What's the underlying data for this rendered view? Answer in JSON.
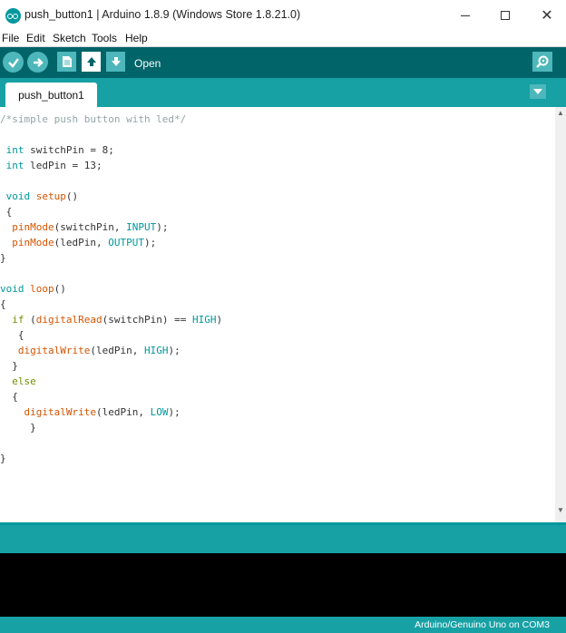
{
  "window": {
    "title": "push_button1 | Arduino 1.8.9 (Windows Store 1.8.21.0)",
    "minimize_glyph": "",
    "close_glyph": "✕"
  },
  "menu": [
    "File",
    "Edit",
    "Sketch",
    "Tools",
    "Help"
  ],
  "toolbar": {
    "hover_label": "Open",
    "buttons": [
      "verify-icon",
      "upload-icon",
      "new-icon",
      "open-icon",
      "save-icon"
    ],
    "right_button": "serial-monitor-icon"
  },
  "tabs": [
    {
      "label": "push_button1",
      "active": true
    }
  ],
  "colors": {
    "toolbar_bg": "#006468",
    "tab_bar_bg": "#17a1a5",
    "button_bg": "#4db7bb",
    "keyword_type": "#00979c",
    "function": "#d35400",
    "comment": "#95a5a6",
    "console_bg": "#000000"
  },
  "code": [
    [
      {
        "t": "/*simple push button with led*/",
        "c": "cm"
      }
    ],
    [],
    [
      {
        "t": " "
      },
      {
        "t": "int",
        "c": "ty"
      },
      {
        "t": " switchPin = 8;"
      }
    ],
    [
      {
        "t": " "
      },
      {
        "t": "int",
        "c": "ty"
      },
      {
        "t": " ledPin = 13;"
      }
    ],
    [],
    [
      {
        "t": " "
      },
      {
        "t": "void",
        "c": "ty"
      },
      {
        "t": " "
      },
      {
        "t": "setup",
        "c": "fn"
      },
      {
        "t": "()"
      }
    ],
    [
      {
        "t": " {"
      }
    ],
    [
      {
        "t": "  "
      },
      {
        "t": "pinMode",
        "c": "fn"
      },
      {
        "t": "(switchPin, "
      },
      {
        "t": "INPUT",
        "c": "cs"
      },
      {
        "t": ");"
      }
    ],
    [
      {
        "t": "  "
      },
      {
        "t": "pinMode",
        "c": "fn"
      },
      {
        "t": "(ledPin, "
      },
      {
        "t": "OUTPUT",
        "c": "cs"
      },
      {
        "t": ");"
      }
    ],
    [
      {
        "t": "}"
      }
    ],
    [],
    [
      {
        "t": "void",
        "c": "ty"
      },
      {
        "t": " "
      },
      {
        "t": "loop",
        "c": "fn"
      },
      {
        "t": "()"
      }
    ],
    [
      {
        "t": "{"
      }
    ],
    [
      {
        "t": "  "
      },
      {
        "t": "if",
        "c": "kw"
      },
      {
        "t": " ("
      },
      {
        "t": "digitalRead",
        "c": "fn"
      },
      {
        "t": "(switchPin) == "
      },
      {
        "t": "HIGH",
        "c": "cs"
      },
      {
        "t": ")"
      }
    ],
    [
      {
        "t": "   {"
      }
    ],
    [
      {
        "t": "   "
      },
      {
        "t": "digitalWrite",
        "c": "fn"
      },
      {
        "t": "(ledPin, "
      },
      {
        "t": "HIGH",
        "c": "cs"
      },
      {
        "t": ");"
      }
    ],
    [
      {
        "t": "  }"
      }
    ],
    [
      {
        "t": "  "
      },
      {
        "t": "else",
        "c": "kw"
      }
    ],
    [
      {
        "t": "  {"
      }
    ],
    [
      {
        "t": "    "
      },
      {
        "t": "digitalWrite",
        "c": "fn"
      },
      {
        "t": "(ledPin, "
      },
      {
        "t": "LOW",
        "c": "cs"
      },
      {
        "t": ");"
      }
    ],
    [
      {
        "t": "     }"
      }
    ],
    [],
    [
      {
        "t": "}"
      }
    ]
  ],
  "status": {
    "board": "Arduino/Genuino Uno on COM3"
  }
}
